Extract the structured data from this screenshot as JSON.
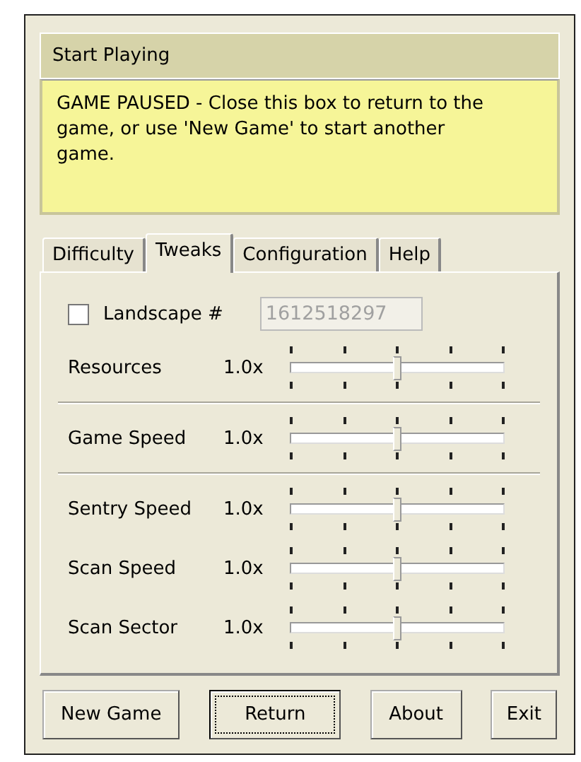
{
  "header": {
    "title": "Start Playing"
  },
  "message": "GAME PAUSED - Close this box to return to the game, or use 'New Game' to start another game.",
  "tabs": [
    {
      "label": "Difficulty",
      "selected": false
    },
    {
      "label": "Tweaks",
      "selected": true
    },
    {
      "label": "Configuration",
      "selected": false
    },
    {
      "label": "Help",
      "selected": false
    }
  ],
  "landscape": {
    "label": "Landscape #",
    "checked": false,
    "value": "1612518297",
    "disabled": true
  },
  "sliders": [
    {
      "name": "Resources",
      "reading": "1.0x",
      "level": 0.5,
      "divider_after": true
    },
    {
      "name": "Game Speed",
      "reading": "1.0x",
      "level": 0.5,
      "divider_after": true
    },
    {
      "name": "Sentry Speed",
      "reading": "1.0x",
      "level": 0.5,
      "divider_after": false
    },
    {
      "name": "Scan Speed",
      "reading": "1.0x",
      "level": 0.5,
      "divider_after": false
    },
    {
      "name": "Scan Sector",
      "reading": "1.0x",
      "level": 0.5,
      "divider_after": false
    }
  ],
  "buttons": [
    {
      "label": "New Game",
      "default": false
    },
    {
      "label": "Return",
      "default": true
    },
    {
      "label": "About",
      "default": false
    },
    {
      "label": "Exit",
      "default": false
    }
  ]
}
